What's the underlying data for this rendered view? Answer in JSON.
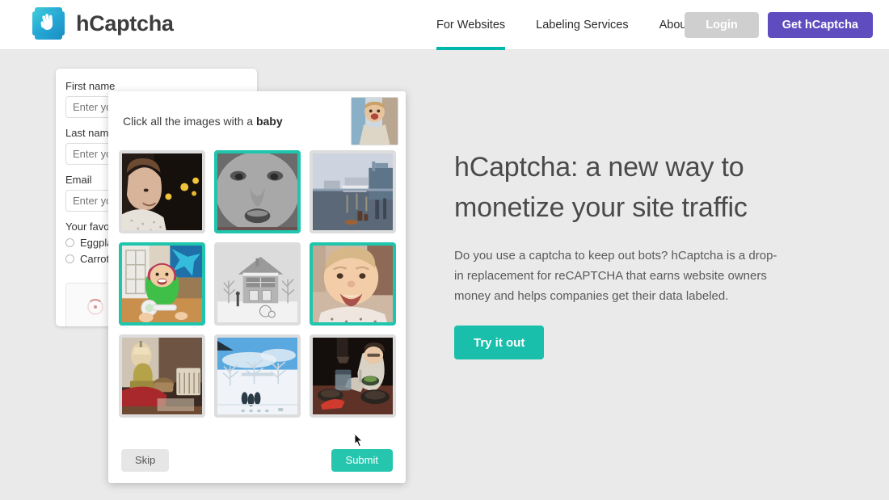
{
  "header": {
    "brand_name": "hCaptcha",
    "logo_icon": "waving-hand-logo",
    "nav": [
      {
        "label": "For Websites",
        "active": true
      },
      {
        "label": "Labeling Services",
        "active": false
      },
      {
        "label": "About",
        "active": false
      }
    ],
    "login_label": "Login",
    "get_label": "Get hCaptcha",
    "accent_teal": "#00b7ac",
    "purple": "#5f4dc0"
  },
  "form": {
    "fields": [
      {
        "label": "First name",
        "placeholder": "Enter your first name",
        "value": ""
      },
      {
        "label": "Last name",
        "placeholder": "Enter your last name",
        "value": ""
      },
      {
        "label": "Email",
        "placeholder": "Enter your email",
        "value": ""
      }
    ],
    "radio_label": "Your favorite vegetable",
    "radios": [
      {
        "label": "Eggplant",
        "checked": false
      },
      {
        "label": "Carrot",
        "checked": false
      }
    ],
    "checkbox_widget_icon": "loading-spinner-icon"
  },
  "captcha": {
    "prompt_prefix": "Click all the images with a ",
    "prompt_target": "baby",
    "example_alt": "baby-example-thumbnail",
    "skip_label": "Skip",
    "submit_label": "Submit",
    "selected_color": "#1fc5ac",
    "tiles": [
      {
        "alt": "smiling-man-at-night",
        "selected": false
      },
      {
        "alt": "baby-face-grayscale",
        "selected": true
      },
      {
        "alt": "harbor-with-ship-and-crane",
        "selected": false
      },
      {
        "alt": "baby-in-green-jacket-with-rattle",
        "selected": true
      },
      {
        "alt": "snowy-house-grayscale",
        "selected": false
      },
      {
        "alt": "smiling-baby-closeup",
        "selected": true
      },
      {
        "alt": "bedroom-with-red-bed-and-crib",
        "selected": false
      },
      {
        "alt": "snowy-garden-blue-sky",
        "selected": false
      },
      {
        "alt": "woman-cooking-at-table",
        "selected": false
      }
    ]
  },
  "hero": {
    "title": "hCaptcha: a new way to monetize your site traffic",
    "body": "Do you use a captcha to keep out bots? hCaptcha is a drop-in replacement for reCAPTCHA that earns website owners money and helps companies get their data labeled.",
    "cta_label": "Try it out",
    "cta_color": "#19bfab"
  }
}
